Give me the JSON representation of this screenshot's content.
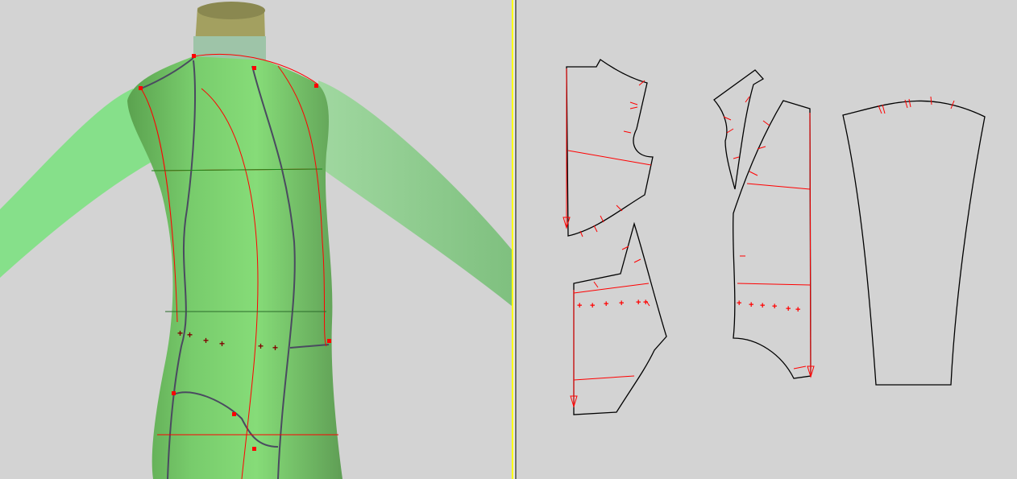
{
  "colors": {
    "background": "#d3d3d3",
    "body_green": "#7ed67a",
    "sleeve_green": "#8ed88c",
    "neck_olive": "#a3a060",
    "seam_red": "#ff0000",
    "seam_dark": "#4a4a60",
    "pattern_outline": "#000000",
    "splitter_yellow": "#ffff00"
  },
  "views": {
    "left": "3d-avatar-view",
    "right": "2d-pattern-view"
  }
}
